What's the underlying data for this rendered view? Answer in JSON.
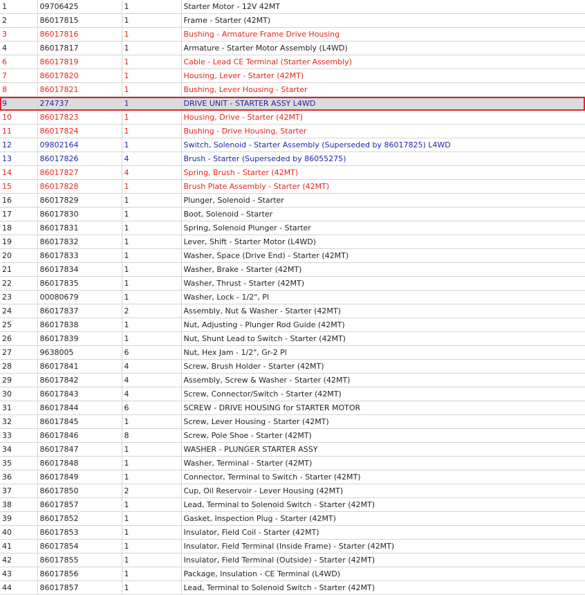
{
  "colors": {
    "default": "#222222",
    "red": "#e8221a",
    "blue": "#1f25a6",
    "selected_bg": "#dcdcdc",
    "selected_border": "#e2252b"
  },
  "selected_index": 7,
  "rows": [
    {
      "ref": "1",
      "part": "09706425",
      "qty": "1",
      "desc": "Starter Motor - 12V 42MT",
      "status": "default"
    },
    {
      "ref": "2",
      "part": "86017815",
      "qty": "1",
      "desc": "Frame - Starter (42MT)",
      "status": "default"
    },
    {
      "ref": "3",
      "part": "86017816",
      "qty": "1",
      "desc": "Bushing - Armature Frame Drive Housing",
      "status": "red"
    },
    {
      "ref": "4",
      "part": "86017817",
      "qty": "1",
      "desc": "Armature - Starter Motor Assembly (L4WD)",
      "status": "default"
    },
    {
      "ref": "6",
      "part": "86017819",
      "qty": "1",
      "desc": "Cable - Lead CE Terminal (Starter Assembly)",
      "status": "red"
    },
    {
      "ref": "7",
      "part": "86017820",
      "qty": "1",
      "desc": "Housing, Lever - Starter (42MT)",
      "status": "red"
    },
    {
      "ref": "8",
      "part": "86017821",
      "qty": "1",
      "desc": "Bushing, Lever Housing - Starter",
      "status": "red"
    },
    {
      "ref": "9",
      "part": "274737",
      "qty": "1",
      "desc": "DRIVE UNIT - STARTER ASSY L4WD",
      "status": "blue"
    },
    {
      "ref": "10",
      "part": "86017823",
      "qty": "1",
      "desc": "Housing, Drive - Starter (42MT)",
      "status": "red"
    },
    {
      "ref": "11",
      "part": "86017824",
      "qty": "1",
      "desc": "Bushing - Drive Housing, Starter",
      "status": "red"
    },
    {
      "ref": "12",
      "part": "09802164",
      "qty": "1",
      "desc": "Switch, Solenoid - Starter Assembly (Superseded by 86017825) L4WD",
      "status": "blue"
    },
    {
      "ref": "13",
      "part": "86017826",
      "qty": "4",
      "desc": "Brush - Starter (Superseded by 86055275)",
      "status": "blue"
    },
    {
      "ref": "14",
      "part": "86017827",
      "qty": "4",
      "desc": "Spring, Brush - Starter (42MT)",
      "status": "red"
    },
    {
      "ref": "15",
      "part": "86017828",
      "qty": "1",
      "desc": "Brush Plate Assembly - Starter (42MT)",
      "status": "red"
    },
    {
      "ref": "16",
      "part": "86017829",
      "qty": "1",
      "desc": "Plunger, Solenoid - Starter",
      "status": "default"
    },
    {
      "ref": "17",
      "part": "86017830",
      "qty": "1",
      "desc": "Boot, Solenoid - Starter",
      "status": "default"
    },
    {
      "ref": "18",
      "part": "86017831",
      "qty": "1",
      "desc": "Spring, Solenoid Plunger - Starter",
      "status": "default"
    },
    {
      "ref": "19",
      "part": "86017832",
      "qty": "1",
      "desc": "Lever, Shift - Starter Motor (L4WD)",
      "status": "default"
    },
    {
      "ref": "20",
      "part": "86017833",
      "qty": "1",
      "desc": "Washer, Space (Drive End) - Starter (42MT)",
      "status": "default"
    },
    {
      "ref": "21",
      "part": "86017834",
      "qty": "1",
      "desc": "Washer, Brake - Starter (42MT)",
      "status": "default"
    },
    {
      "ref": "22",
      "part": "86017835",
      "qty": "1",
      "desc": "Washer, Thrust - Starter (42MT)",
      "status": "default"
    },
    {
      "ref": "23",
      "part": "00080679",
      "qty": "1",
      "desc": "Washer, Lock - 1/2\", Pl",
      "status": "default"
    },
    {
      "ref": "24",
      "part": "86017837",
      "qty": "2",
      "desc": "Assembly, Nut & Washer - Starter (42MT)",
      "status": "default"
    },
    {
      "ref": "25",
      "part": "86017838",
      "qty": "1",
      "desc": "Nut, Adjusting - Plunger Rod Guide (42MT)",
      "status": "default"
    },
    {
      "ref": "26",
      "part": "86017839",
      "qty": "1",
      "desc": "Nut, Shunt Lead to Switch - Starter (42MT)",
      "status": "default"
    },
    {
      "ref": "27",
      "part": "9638005",
      "qty": "6",
      "desc": "Nut, Hex Jam - 1/2\", Gr-2 Pl",
      "status": "default"
    },
    {
      "ref": "28",
      "part": "86017841",
      "qty": "4",
      "desc": "Screw, Brush Holder - Starter (42MT)",
      "status": "default"
    },
    {
      "ref": "29",
      "part": "86017842",
      "qty": "4",
      "desc": "Assembly, Screw & Washer - Starter (42MT)",
      "status": "default"
    },
    {
      "ref": "30",
      "part": "86017843",
      "qty": "4",
      "desc": "Screw, Connector/Switch - Starter (42MT)",
      "status": "default"
    },
    {
      "ref": "31",
      "part": "86017844",
      "qty": "6",
      "desc": "SCREW - DRIVE HOUSING for STARTER MOTOR",
      "status": "default"
    },
    {
      "ref": "32",
      "part": "86017845",
      "qty": "1",
      "desc": "Screw, Lever Housing - Starter (42MT)",
      "status": "default"
    },
    {
      "ref": "33",
      "part": "86017846",
      "qty": "8",
      "desc": "Screw, Pole Shoe - Starter (42MT)",
      "status": "default"
    },
    {
      "ref": "34",
      "part": "86017847",
      "qty": "1",
      "desc": "WASHER - PLUNGER STARTER ASSY",
      "status": "default"
    },
    {
      "ref": "35",
      "part": "86017848",
      "qty": "1",
      "desc": "Washer, Terminal - Starter (42MT)",
      "status": "default"
    },
    {
      "ref": "36",
      "part": "86017849",
      "qty": "1",
      "desc": "Connector, Terminal to Switch - Starter (42MT)",
      "status": "default"
    },
    {
      "ref": "37",
      "part": "86017850",
      "qty": "2",
      "desc": "Cup, Oil Reservoir - Lever Housing (42MT)",
      "status": "default"
    },
    {
      "ref": "38",
      "part": "86017857",
      "qty": "1",
      "desc": "Lead, Terminal to Solenoid Switch - Starter (42MT)",
      "status": "default"
    },
    {
      "ref": "39",
      "part": "86017852",
      "qty": "1",
      "desc": "Gasket, Inspection Plug - Starter (42MT)",
      "status": "default"
    },
    {
      "ref": "40",
      "part": "86017853",
      "qty": "1",
      "desc": "Insulator, Field Coil - Starter (42MT)",
      "status": "default"
    },
    {
      "ref": "41",
      "part": "86017854",
      "qty": "1",
      "desc": "Insulator, Field Terminal (Inside Frame) - Starter (42MT)",
      "status": "default"
    },
    {
      "ref": "42",
      "part": "86017855",
      "qty": "1",
      "desc": "Insulator, Field Terminal (Outside) - Starter (42MT)",
      "status": "default"
    },
    {
      "ref": "43",
      "part": "86017856",
      "qty": "1",
      "desc": "Package, Insulation - CE Terminal (L4WD)",
      "status": "default"
    },
    {
      "ref": "44",
      "part": "86017857",
      "qty": "1",
      "desc": "Lead, Terminal to Solenoid Switch - Starter (42MT)",
      "status": "default"
    }
  ]
}
